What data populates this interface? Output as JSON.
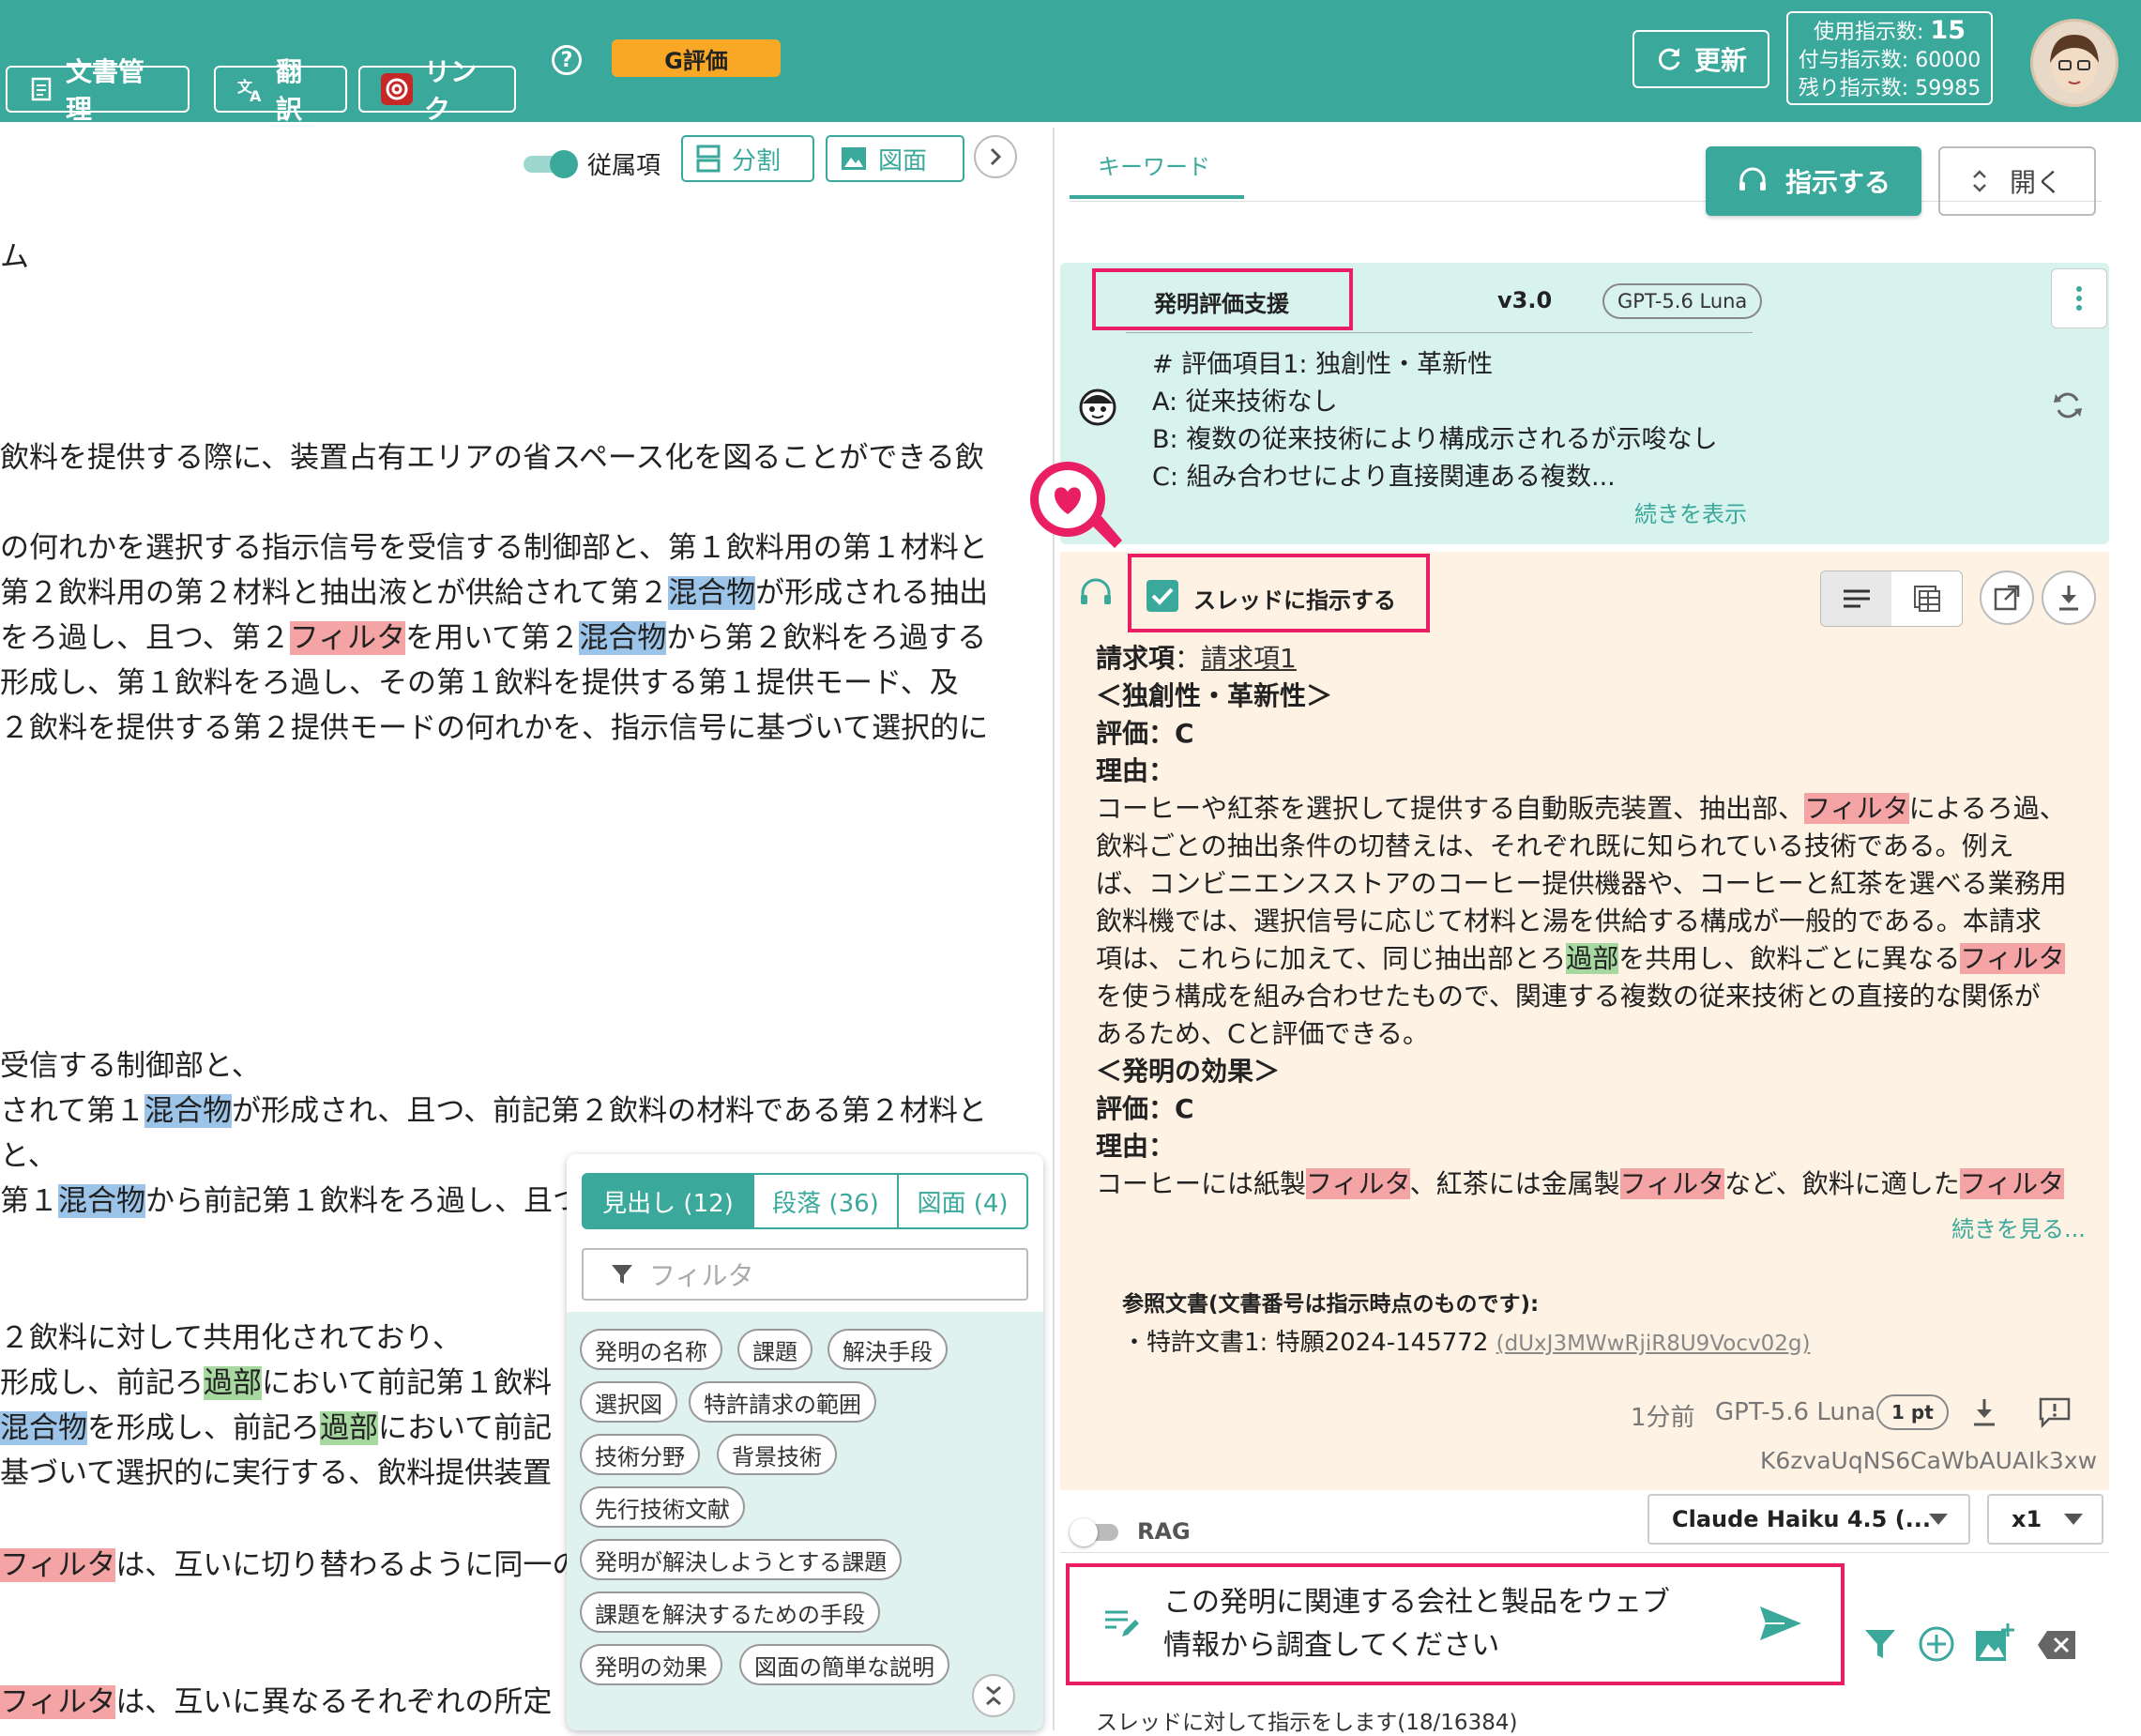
{
  "header": {
    "doc_mgmt": "文書管理",
    "translate": "翻訳",
    "link": "リンク",
    "help": "?",
    "g_eval": "G評価",
    "refresh": "更新",
    "usage_label": "使用指示数:",
    "usage_value": "15",
    "granted_label": "付与指示数:",
    "granted_value": "60000",
    "remaining_label": "残り指示数:",
    "remaining_value": "59985",
    "accent_color": "#3aa99b"
  },
  "doc_toolbar": {
    "dependent_toggle": "従属項",
    "split": "分割",
    "figure": "図面"
  },
  "doc": {
    "l1": "ム",
    "l2": "飲料を提供する際に、装置占有エリアの省スペース化を図ることができる飲",
    "l3": "の何れかを選択する指示信号を受信する制御部と、第１飲料用の第１材料と",
    "l4a": "第２飲料用の第２材料と抽出液とが供給されて第２",
    "l4b": "混合物",
    "l4c": "が形成される抽出",
    "l5a": "をろ過し、且つ、第２",
    "l5b": "フィルタ",
    "l5c": "を用いて第２",
    "l5d": "混合物",
    "l5e": "から第２飲料をろ過する",
    "l6": "形成し、第１飲料をろ過し、その第１飲料を提供する第１提供モード、及",
    "l7": "２飲料を提供する第２提供モードの何れかを、指示信号に基づいて選択的に",
    "l8": "受信する制御部と、",
    "l9a": "されて第１",
    "l9b": "混合物",
    "l9c": "が形成され、且つ、前記第２飲料の材料である第２材料と",
    "l10": "と、",
    "l11a": "第１",
    "l11b": "混合物",
    "l11c": "から前記第１飲料をろ過し、且つ",
    "l12": "２飲料に対して共用化されており、",
    "l13a": "形成し、前記ろ",
    "l13b": "過部",
    "l13c": "において前記第１飲料",
    "l14a": "混合物",
    "l14b": "を形成し、前記ろ",
    "l14c": "過部",
    "l14d": "において前記",
    "l15": "基づいて選択的に実行する、飲料提供装置",
    "l16a": "フィルタ",
    "l16b": "は、互いに切り替わるように同一の",
    "l17a": "フィルタ",
    "l17b": "は、互いに異なるそれぞれの所定"
  },
  "nav_popup": {
    "tabs": [
      "見出し (12)",
      "段落 (36)",
      "図面 (4)"
    ],
    "filter_placeholder": "フィルタ",
    "chips": [
      "発明の名称",
      "課題",
      "解決手段",
      "選択図",
      "特許請求の範囲",
      "技術分野",
      "背景技術",
      "先行技術文献",
      "発明が解決しようとする課題",
      "課題を解決するための手段",
      "発明の効果",
      "図面の簡単な説明"
    ]
  },
  "right": {
    "keyword_tab": "キーワード",
    "instruct_button": "指示する",
    "open_button": "開く",
    "assistant": {
      "name": "発明評価支援",
      "version": "v3.0",
      "model_badge": "GPT-5.6 Luna",
      "lines": [
        "# 評価項目1: 独創性・革新性",
        "A: 従来技術なし",
        "B: 複数の従来技術により構成示されるが示唆なし",
        "C: 組み合わせにより直接関連ある複数..."
      ],
      "show_more": "続きを表示"
    },
    "thread_checkbox": "スレッドに指示する",
    "reply": {
      "claim_label": "請求項",
      "claim_sep": "：",
      "claim_link": "請求項1",
      "h1": "＜独創性・革新性＞",
      "eval1": "評価：C",
      "reason1": "理由：",
      "p1": "コーヒーや紅茶を選択して提供する自動販売装置、抽出部、",
      "p1hl": "フィルタ",
      "p1b": "によるろ過、",
      "p2": "飲料ごとの抽出条件の切替えは、それぞれ既に知られている技術である。例え",
      "p3": "ば、コンビニエンスストアのコーヒー提供機器や、コーヒーと紅茶を選べる業務用",
      "p4": "飲料機では、選択信号に応じて材料と湯を供給する構成が一般的である。本請求",
      "p5a": "項は、これらに加えて、同じ抽出部とろ",
      "p5b": "過部",
      "p5c": "を共用し、飲料ごとに異なる",
      "p5d": "フィルタ",
      "p6": "を使う構成を組み合わせたもので、関連する複数の従来技術との直接的な関係が",
      "p7": "あるため、Cと評価できる。",
      "h2": "＜発明の効果＞",
      "eval2": "評価：C",
      "reason2": "理由：",
      "q1a": "コーヒーには紙製",
      "q1b": "フィルタ",
      "q1c": "、紅茶には金属製",
      "q1d": "フィルタ",
      "q1e": "など、飲料に適した",
      "q1f": "フィルタ",
      "more": "続きを見る...",
      "ref_title": "参照文書(文書番号は指示時点のものです):",
      "ref_item": "・特許文書1: 特願2024-145772",
      "ref_link": "(dUxJ3MWwRjiR8U9Vocv02g)",
      "time": "1分前",
      "model": "GPT-5.6 Luna",
      "points": "1 pt",
      "id": "K6zvaUqNS6CaWbAUAIk3xw"
    },
    "rag_label": "RAG",
    "model_select": "Claude Haiku 4.5 (...",
    "multiplier": "x1",
    "input_line1": "この発明に関連する会社と製品をウェブ",
    "input_line2": "情報から調査してください",
    "status": "スレッドに対して指示をします(18/16384)"
  }
}
